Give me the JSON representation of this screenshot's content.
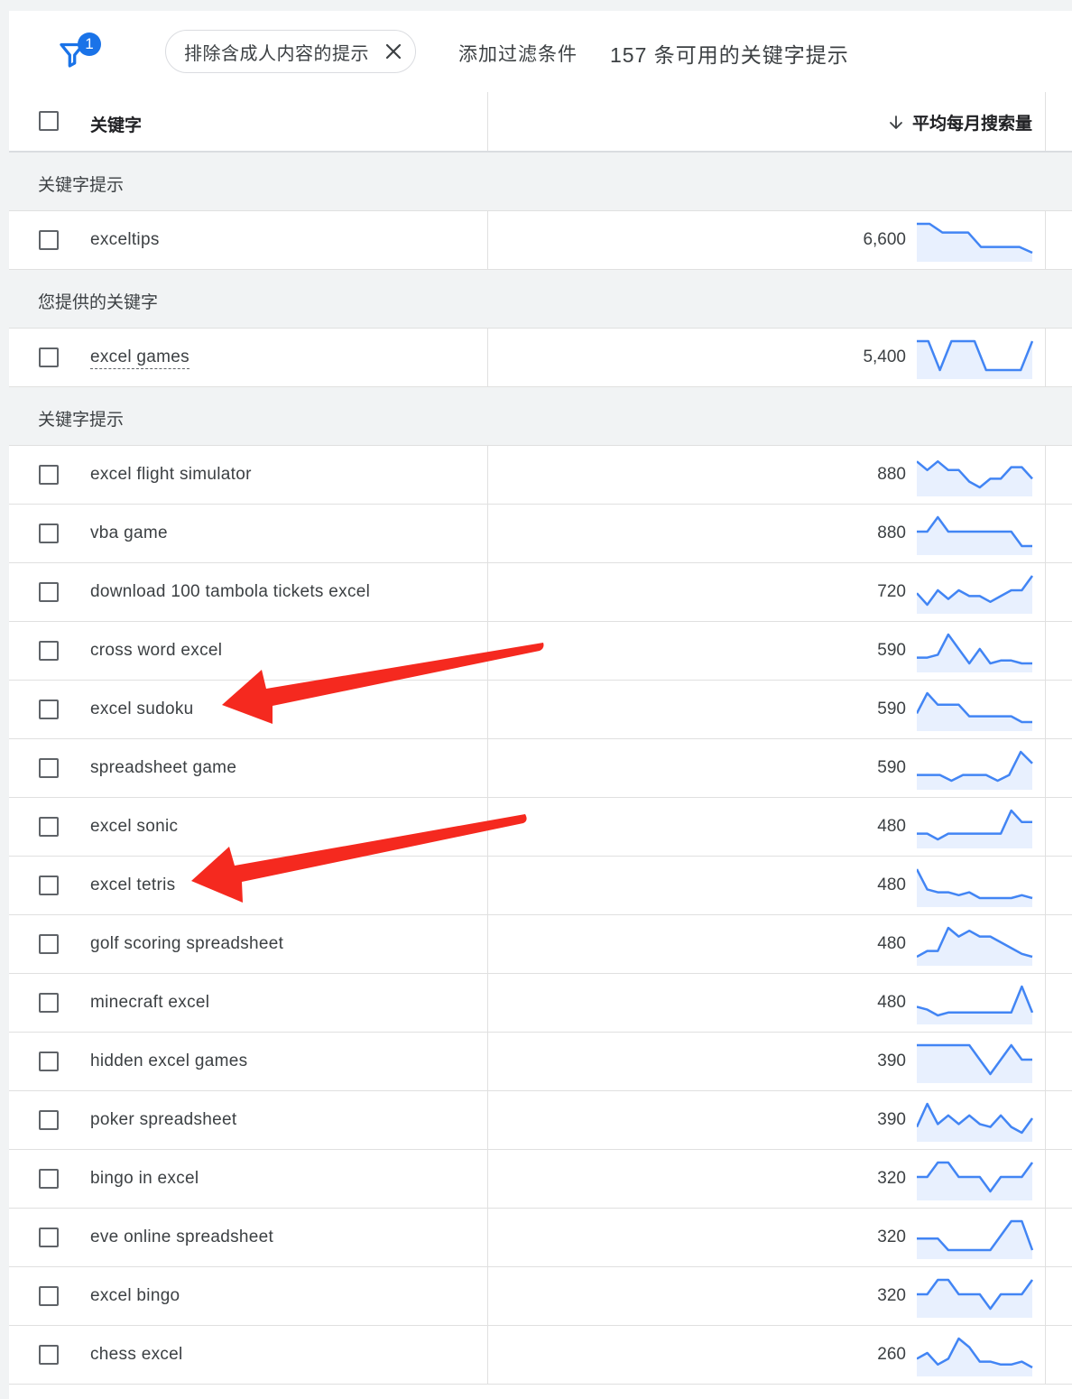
{
  "filter_bar": {
    "filter_count": "1",
    "chip_label": "排除含成人内容的提示",
    "add_filter": "添加过滤条件",
    "count_text": "157 条可用的关键字提示"
  },
  "table_head": {
    "keyword_col": "关键字",
    "volume_col": "平均每月搜索量"
  },
  "colors": {
    "accent": "#1a73e8",
    "trend_line": "#4285f4",
    "trend_fill": "#e8f0fe",
    "arrow": "#f5291f"
  },
  "rows": [
    {
      "kind": "section",
      "label": "关键字提示"
    },
    {
      "kind": "keyword",
      "keyword": "exceltips",
      "volume": "6,600",
      "trend": [
        1,
        1,
        0.7,
        0.7,
        0.7,
        0.2,
        0.2,
        0.2,
        0.2,
        0
      ]
    },
    {
      "kind": "section",
      "label": "您提供的关键字"
    },
    {
      "kind": "keyword",
      "keyword": "excel games",
      "volume": "5,400",
      "underline": true,
      "trend": [
        1,
        1,
        0,
        1,
        1,
        1,
        0,
        0,
        0,
        0,
        1
      ]
    },
    {
      "kind": "section",
      "label": "关键字提示"
    },
    {
      "kind": "keyword",
      "keyword": "excel flight simulator",
      "volume": "880",
      "trend": [
        0.9,
        0.6,
        0.9,
        0.6,
        0.6,
        0.2,
        0,
        0.3,
        0.3,
        0.7,
        0.7,
        0.3
      ]
    },
    {
      "kind": "keyword",
      "keyword": "vba game",
      "volume": "880",
      "trend": [
        0.5,
        0.5,
        1,
        0.5,
        0.5,
        0.5,
        0.5,
        0.5,
        0.5,
        0.5,
        0,
        0
      ]
    },
    {
      "kind": "keyword",
      "keyword": "download 100 tambola tickets excel",
      "volume": "720",
      "trend": [
        0.4,
        0,
        0.5,
        0.2,
        0.5,
        0.3,
        0.3,
        0.1,
        0.3,
        0.5,
        0.5,
        1
      ]
    },
    {
      "kind": "keyword",
      "keyword": "cross word excel",
      "volume": "590",
      "trend": [
        0.2,
        0.2,
        0.3,
        1,
        0.5,
        0,
        0.5,
        0,
        0.1,
        0.1,
        0,
        0
      ]
    },
    {
      "kind": "keyword",
      "keyword": "excel sudoku",
      "volume": "590",
      "trend": [
        0.3,
        1,
        0.6,
        0.6,
        0.6,
        0.2,
        0.2,
        0.2,
        0.2,
        0.2,
        0,
        0
      ]
    },
    {
      "kind": "keyword",
      "keyword": "spreadsheet game",
      "volume": "590",
      "trend": [
        0.2,
        0.2,
        0.2,
        0,
        0.2,
        0.2,
        0.2,
        0,
        0.2,
        1,
        0.6
      ]
    },
    {
      "kind": "keyword",
      "keyword": "excel sonic",
      "volume": "480",
      "trend": [
        0.2,
        0.2,
        0,
        0.2,
        0.2,
        0.2,
        0.2,
        0.2,
        0.2,
        1,
        0.6,
        0.6
      ]
    },
    {
      "kind": "keyword",
      "keyword": "excel tetris",
      "volume": "480",
      "trend": [
        1,
        0.3,
        0.2,
        0.2,
        0.1,
        0.2,
        0,
        0,
        0,
        0,
        0.1,
        0
      ]
    },
    {
      "kind": "keyword",
      "keyword": "golf scoring spreadsheet",
      "volume": "480",
      "trend": [
        0,
        0.2,
        0.2,
        1,
        0.7,
        0.9,
        0.7,
        0.7,
        0.5,
        0.3,
        0.1,
        0
      ]
    },
    {
      "kind": "keyword",
      "keyword": "minecraft excel",
      "volume": "480",
      "trend": [
        0.3,
        0.2,
        0,
        0.1,
        0.1,
        0.1,
        0.1,
        0.1,
        0.1,
        0.1,
        1,
        0.1
      ]
    },
    {
      "kind": "keyword",
      "keyword": "hidden excel games",
      "volume": "390",
      "trend": [
        1,
        1,
        1,
        1,
        1,
        1,
        0.5,
        0,
        0.5,
        1,
        0.5,
        0.5
      ]
    },
    {
      "kind": "keyword",
      "keyword": "poker spreadsheet",
      "volume": "390",
      "trend": [
        0.2,
        1,
        0.3,
        0.6,
        0.3,
        0.6,
        0.3,
        0.2,
        0.6,
        0.2,
        0,
        0.5
      ]
    },
    {
      "kind": "keyword",
      "keyword": "bingo in excel",
      "volume": "320",
      "trend": [
        0.5,
        0.5,
        1,
        1,
        0.5,
        0.5,
        0.5,
        0,
        0.5,
        0.5,
        0.5,
        1
      ]
    },
    {
      "kind": "keyword",
      "keyword": "eve online spreadsheet",
      "volume": "320",
      "trend": [
        0.4,
        0.4,
        0.4,
        0,
        0,
        0,
        0,
        0,
        0.5,
        1,
        1,
        0
      ]
    },
    {
      "kind": "keyword",
      "keyword": "excel bingo",
      "volume": "320",
      "trend": [
        0.5,
        0.5,
        1,
        1,
        0.5,
        0.5,
        0.5,
        0,
        0.5,
        0.5,
        0.5,
        1
      ]
    },
    {
      "kind": "keyword",
      "keyword": "chess excel",
      "volume": "260",
      "trend": [
        0.3,
        0.5,
        0.1,
        0.3,
        1,
        0.7,
        0.2,
        0.2,
        0.1,
        0.1,
        0.2,
        0
      ]
    }
  ]
}
